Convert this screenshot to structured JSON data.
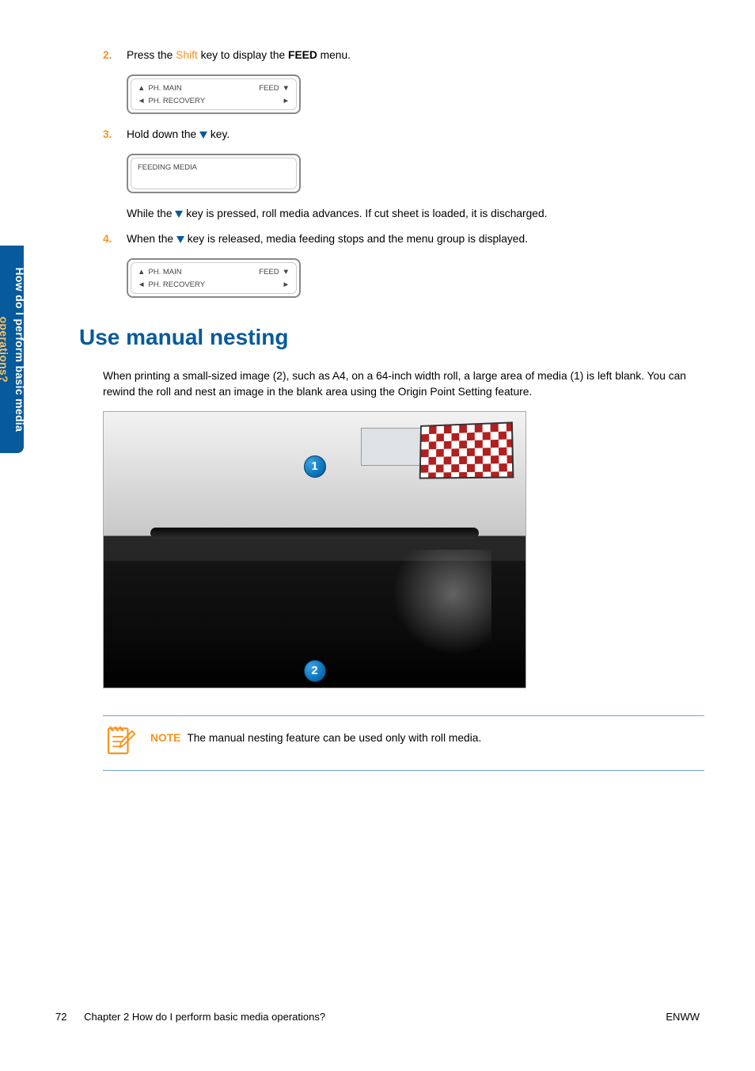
{
  "sidebar": {
    "line1": "How do I perform basic media",
    "line2": "operations?"
  },
  "steps": {
    "s2": {
      "num": "2.",
      "prefix": "Press the ",
      "shift": "Shift",
      "mid": " key to display the ",
      "bold": "FEED",
      "suffix": " menu."
    },
    "lcd1": {
      "top_left": "PH. MAIN",
      "top_right": "FEED",
      "bot_left": "PH. RECOVERY"
    },
    "s3": {
      "num": "3.",
      "prefix": "Hold down the ",
      "suffix": " key."
    },
    "lcd2": {
      "line": "FEEDING MEDIA"
    },
    "para_while": {
      "prefix": "While the ",
      "suffix": " key is pressed, roll media advances. If cut sheet is loaded, it is discharged."
    },
    "s4": {
      "num": "4.",
      "prefix": "When the ",
      "suffix": " key is released, media feeding stops and the menu group is displayed."
    },
    "lcd3": {
      "top_left": "PH. MAIN",
      "top_right": "FEED",
      "bot_left": "PH. RECOVERY"
    }
  },
  "section": {
    "title": "Use manual nesting",
    "intro": "When printing a small-sized image (2), such as A4, on a 64-inch width roll, a large area of media (1) is left blank. You can rewind the roll and nest an image in the blank area using the Origin Point Setting feature."
  },
  "bubbles": {
    "one": "1",
    "two": "2"
  },
  "note": {
    "label": "NOTE",
    "text": "The manual nesting feature can be used only with roll media."
  },
  "footer": {
    "left_num": "72",
    "left_text": "Chapter 2   How do I perform basic media operations?",
    "right": "ENWW"
  }
}
